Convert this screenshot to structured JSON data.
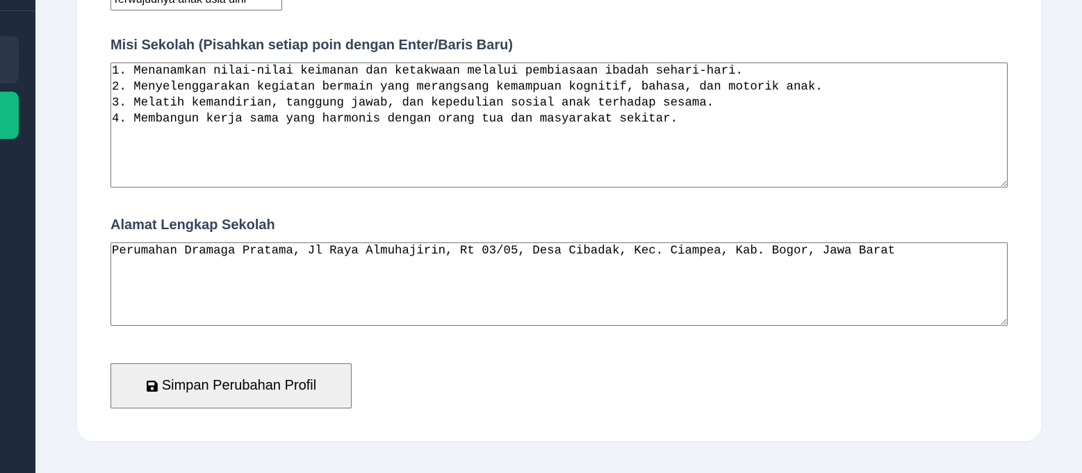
{
  "partial_field": {
    "value": "Terwujudnya anak usia dini"
  },
  "misi": {
    "label": "Misi Sekolah (Pisahkan setiap poin dengan Enter/Baris Baru)",
    "value": "1. Menanamkan nilai-nilai keimanan dan ketakwaan melalui pembiasaan ibadah sehari-hari.\n2. Menyelenggarakan kegiatan bermain yang merangsang kemampuan kognitif, bahasa, dan motorik anak.\n3. Melatih kemandirian, tanggung jawab, dan kepedulian sosial anak terhadap sesama.\n4. Membangun kerja sama yang harmonis dengan orang tua dan masyarakat sekitar."
  },
  "alamat": {
    "label": "Alamat Lengkap Sekolah",
    "value": "Perumahan Dramaga Pratama, Jl Raya Almuhajirin, Rt 03/05, Desa Cibadak, Kec. Ciampea, Kab. Bogor, Jawa Barat"
  },
  "actions": {
    "save_label": "Simpan Perubahan Profil",
    "save_icon": "floppy-disk-icon"
  },
  "colors": {
    "sidebar_bg": "#1f2a3a",
    "sidebar_active": "#10bb81",
    "page_bg": "#f0f3f8",
    "label_text": "#34455b"
  }
}
